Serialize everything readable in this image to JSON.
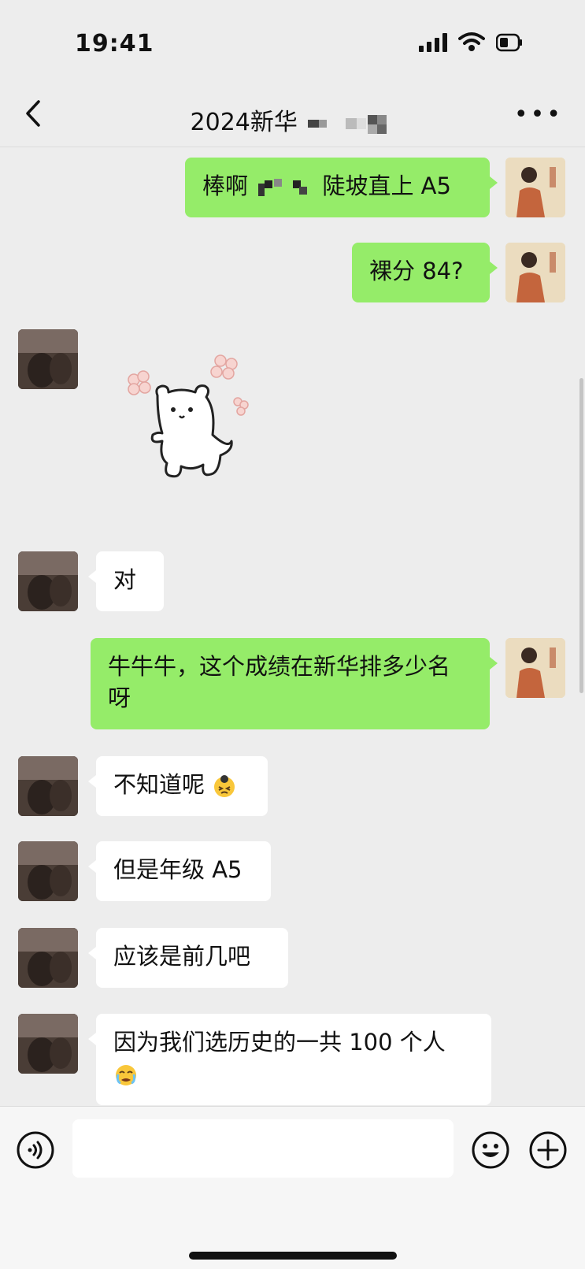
{
  "status_bar": {
    "time": "19:41"
  },
  "header": {
    "title": "2024新华"
  },
  "messages": [
    {
      "side": "me",
      "text": "棒啊",
      "text_suffix": "陡坡直上 A5"
    },
    {
      "side": "me",
      "text": "裸分 84?"
    },
    {
      "side": "other",
      "type": "sticker",
      "sticker": "bear-sticker"
    },
    {
      "side": "other",
      "text": "对"
    },
    {
      "side": "me",
      "text": "牛牛牛，这个成绩在新华排多少名呀"
    },
    {
      "side": "other",
      "text": "不知道呢",
      "emoji": "embarrassed-face"
    },
    {
      "side": "other",
      "text": "但是年级 A5"
    },
    {
      "side": "other",
      "text": "应该是前几吧"
    },
    {
      "side": "other",
      "text": "因为我们选历史的一共 100 个人",
      "emoji": "crying-face"
    }
  ],
  "input": {
    "value": ""
  },
  "icons": {
    "back": "chevron-left-icon",
    "more": "more-icon",
    "voice": "voice-icon",
    "emoji": "smile-icon",
    "plus": "plus-icon"
  },
  "colors": {
    "background": "#ededed",
    "my_bubble": "#95ec69",
    "other_bubble": "#ffffff"
  }
}
